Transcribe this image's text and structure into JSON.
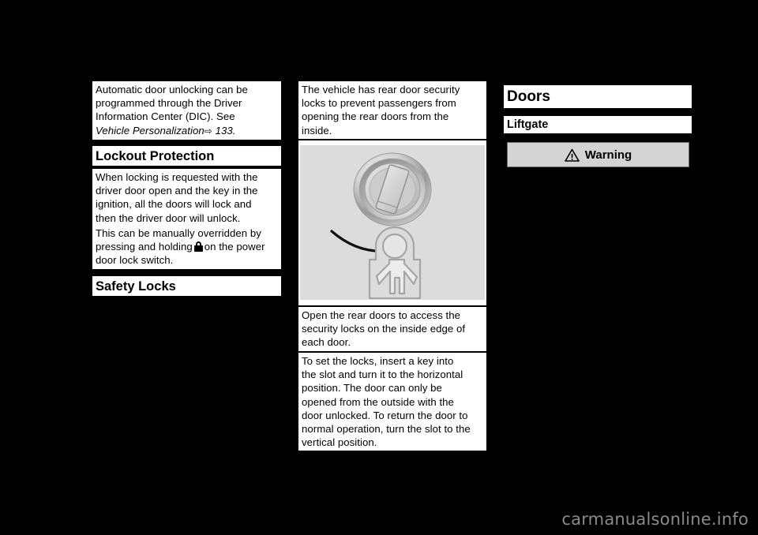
{
  "page": {
    "background_color": "#000000",
    "text_color": "#000000",
    "block_color": "#ffffff"
  },
  "columns": [
    {
      "id": "column-left",
      "blocks": [
        {
          "type": "paragraph",
          "name": "automatic-door-unlocking-paragraph",
          "lines": [
            "Automatic door unlocking can be",
            "programmed through the Driver",
            "Information Center (DIC). See"
          ],
          "xref": {
            "italic_text": "Vehicle Personalization",
            "arrow": "⇨",
            "page": "133."
          }
        },
        {
          "type": "heading",
          "name": "lockout-protection-heading",
          "level": "h2",
          "text": "Lockout Protection"
        },
        {
          "type": "paragraph",
          "name": "lockout-protection-paragraph",
          "lines": [
            "When locking is requested with the",
            "driver door open and the key in the",
            "ignition, all the doors will lock and",
            "then the driver door will unlock."
          ]
        },
        {
          "type": "paragraph",
          "name": "manual-override-paragraph",
          "lines_with_icon": {
            "before": "This can be manually overridden by pressing and holding",
            "icon": "lock-icon",
            "after": "on the power door lock switch."
          }
        },
        {
          "type": "heading",
          "name": "safety-locks-heading",
          "level": "h2",
          "text": "Safety Locks"
        }
      ]
    },
    {
      "id": "column-middle",
      "blocks": [
        {
          "type": "paragraph",
          "name": "rear-door-security-locks-paragraph",
          "lines": [
            "The vehicle has rear door security",
            "locks to prevent passengers from",
            "opening the rear doors from the",
            "inside."
          ]
        },
        {
          "type": "figure",
          "name": "safety-lock-illustration",
          "alt": "Rear door security lock cylinder with curved arrow pointing to child-in-padlock symbol",
          "background_color": "#dcdcdc",
          "parts": [
            "lock-cylinder-icon",
            "curved-arrow-icon",
            "child-safety-lock-icon"
          ]
        },
        {
          "type": "paragraph",
          "name": "open-rear-doors-paragraph",
          "lines": [
            "Open the rear doors to access the",
            "security locks on the inside edge of",
            "each door."
          ]
        },
        {
          "type": "paragraph",
          "name": "set-the-locks-paragraph",
          "lines": [
            "To set the locks, insert a key into",
            "the slot and turn it to the horizontal",
            "position. The door can only be",
            "opened from the outside with the",
            "door unlocked. To return the door to",
            "normal operation, turn the slot to the",
            "vertical position."
          ]
        }
      ]
    },
    {
      "id": "column-right",
      "blocks": [
        {
          "type": "heading",
          "name": "doors-heading",
          "level": "h1",
          "text": "Doors"
        },
        {
          "type": "heading",
          "name": "liftgate-heading",
          "level": "h3",
          "text": "Liftgate"
        },
        {
          "type": "warning",
          "name": "warning-box",
          "icon": "warning-triangle-icon",
          "label": "Warning",
          "background_color": "#d4d4d4",
          "border_color": "#6e6e6e"
        }
      ]
    }
  ],
  "watermark": {
    "text": "carmanualsonline.info",
    "color": "#8a8a8a"
  }
}
